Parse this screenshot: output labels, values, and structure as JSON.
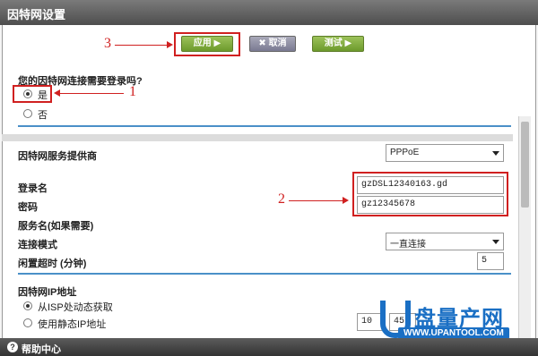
{
  "window": {
    "title": "因特网设置"
  },
  "toolbar": {
    "apply_label": "应用 ▶",
    "cancel_label": "✖ 取消",
    "test_label": "测试 ▶"
  },
  "annotations": {
    "a1": "1",
    "a2": "2",
    "a3": "3"
  },
  "login_question": {
    "title": "您的因特网连接需要登录吗?",
    "yes_label": "是",
    "no_label": "否",
    "selected": "是"
  },
  "provider": {
    "label": "因特网服务提供商",
    "value": "PPPoE"
  },
  "login_name": {
    "label": "登录名",
    "value": "gzDSL12340163.gd"
  },
  "password": {
    "label": "密码",
    "value": "gz12345678"
  },
  "service_name": {
    "label": "服务名(如果需要)"
  },
  "connection_mode": {
    "label": "连接模式",
    "value": "一直连接"
  },
  "idle_timeout": {
    "label": "闲置超时 (分钟)",
    "value": "5"
  },
  "ip_address": {
    "title": "因特网IP地址",
    "dynamic_label": "从ISP处动态获取",
    "static_label": "使用静态IP地址",
    "ip_part1": "10",
    "ip_part2": "45"
  },
  "footer": {
    "help_label": "帮助中心"
  },
  "watermark": {
    "text": "盘量产网",
    "sub": "WWW.UPANTOOL.COM"
  },
  "colors": {
    "annotation_red": "#d02020",
    "divider_blue": "#4a90c8",
    "button_green": "#7aa83a"
  }
}
